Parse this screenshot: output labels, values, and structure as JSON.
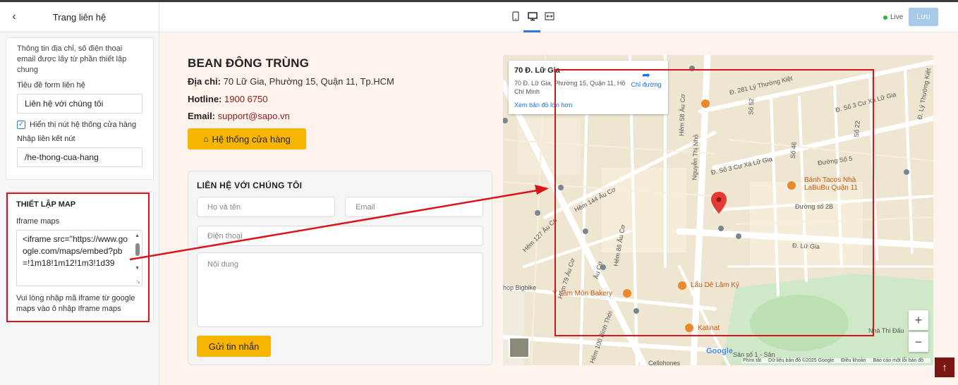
{
  "left_panel": {
    "title": "Trang liên hệ",
    "note": "Thông tin địa chỉ, số điện thoại email được lấy từ phần thiết lập chung",
    "form_title_label": "Tiêu đề form liên hệ",
    "form_title_value": "Liên hệ với chúng tôi",
    "show_store_button_label": "Hiển thị nút hệ thống cửa hàng",
    "link_label": "Nhập liên kết nút",
    "link_value": "/he-thong-cua-hang",
    "map_section_title": "THIẾT LẬP MAP",
    "iframe_label": "Iframe maps",
    "iframe_value": "<iframe src=\"https://www.google.com/maps/embed?pb=!1m18!1m12!1m3!1d39",
    "hint": "Vui lòng nhập mã iframe từ google maps vào ô nhập Iframe maps"
  },
  "toolbar": {
    "live_label": "Live",
    "save_label": "Lưu"
  },
  "preview": {
    "shop_name": "BEAN ĐÔNG TRÙNG",
    "address_label": "Địa chỉ:",
    "address_value": "70 Lữ Gia, Phường 15, Quận 11, Tp.HCM",
    "hotline_label": "Hotline:",
    "hotline_value": "1900 6750",
    "email_label": "Email:",
    "email_value": "support@sapo.vn",
    "store_button": "Hệ thống cửa hàng",
    "form": {
      "title": "LIÊN HỆ VỚI CHÚNG TÔI",
      "name_placeholder": "Họ và tên",
      "email_placeholder": "Email",
      "phone_placeholder": "Điện thoại",
      "content_placeholder": "Nội dung",
      "send_button": "Gửi tin nhắn"
    },
    "map": {
      "card_title": "70 Đ. Lữ Gia",
      "card_address": "70 Đ. Lữ Gia, Phường 15, Quận 11, Hồ Chí Minh",
      "directions": "Chỉ đường",
      "larger_map": "Xem bản đồ lớn hơn",
      "labels": {
        "l1": "Đ. 281 Lý Thường Kiệt",
        "l2": "Đ. Số 3 Cư Xá Lữ Gia",
        "l3": "Đ. Lữ Gia",
        "l4": "Đường số 2B",
        "l5": "Đường Số 5",
        "l6": "Nguyễn Thị Nhỏ",
        "l7": "Hẻm 144 Âu Cơ",
        "l8": "Hẻm 86 Âu Cơ",
        "l9": "Âu Cơ",
        "l10": "Số 52",
        "l11": "Hẻm 127 Âu Cơ",
        "l12": "Hẻm 79 Âu Cơ",
        "l13": "Hẻm 58 Âu Cơ",
        "l14": "Đ. Số 3 Cư Xá Lữ Gia",
        "l15": "Đ. Lý Thường Kiệt",
        "l16": "Hẻm 100 Bình Thới",
        "l17": "Số 46",
        "l18": "Số 22",
        "l19": "hop Bigbike",
        "l20": "Cellphones",
        "l21": "Sân số 1 - Sân",
        "l22": "Nhà Thi Đấu"
      },
      "pois": {
        "p1": "Bánh Tacos Nhà LaBuBu Quận 11",
        "p2": "Lẩu Dê Lâm Ký",
        "p3": "Ý Lâm Môn Bakery",
        "p4": "Katinat"
      },
      "google": "Google",
      "footer": {
        "shortcuts": "Phím tắt",
        "data": "Dữ liệu bản đồ ©2025 Google",
        "terms": "Điều khoản",
        "report": "Báo cáo một lỗi bản đồ"
      }
    }
  }
}
